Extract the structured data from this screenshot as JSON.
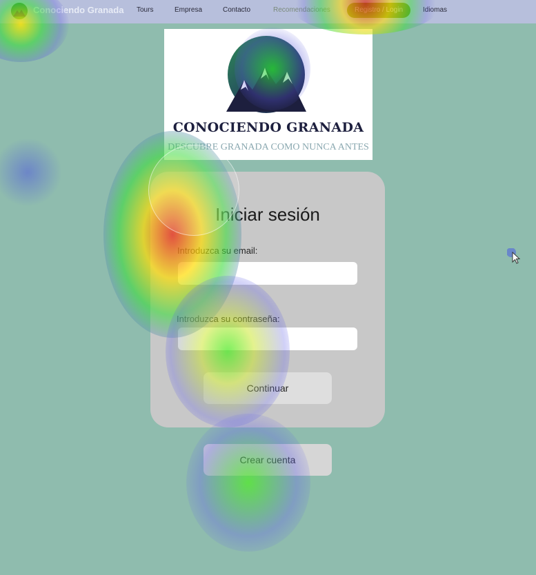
{
  "nav": {
    "brand": "Conociendo Granada",
    "items": [
      "Tours",
      "Empresa",
      "Contacto",
      "Recomendaciones"
    ],
    "login": "Registro / Login",
    "languages": "Idiomas"
  },
  "hero": {
    "title": "CONOCIENDO GRANADA",
    "subtitle": "DESCUBRE GRANADA COMO NUNCA ANTES",
    "logo_icon": "mountain-moon-logo"
  },
  "login": {
    "heading": "Iniciar sesión",
    "email_label": "Introduzca su email:",
    "email_value": "",
    "password_label": "Introduzca su contraseña:",
    "password_value": "",
    "continue_label": "Continuar",
    "create_label": "Crear cuenta"
  },
  "colors": {
    "background": "#8fbcae",
    "nav": "#b7bfdc",
    "card": "#c8c8c8",
    "login_button": "#6a8a1e",
    "logo_navy": "#1d1f3e"
  },
  "icons": {
    "cursor": "mouse-pointer-icon"
  }
}
